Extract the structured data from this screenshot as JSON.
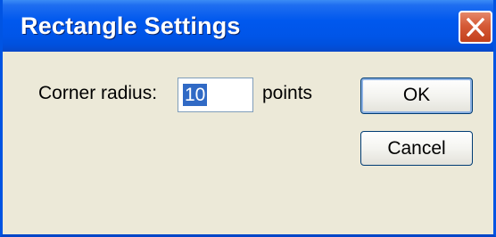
{
  "dialog": {
    "title": "Rectangle Settings",
    "close_icon": "close-icon",
    "corner_radius_label": "Corner radius:",
    "corner_radius_value": "10",
    "units_label": "points",
    "ok_label": "OK",
    "cancel_label": "Cancel"
  },
  "colors": {
    "titlebar": "#0055e8",
    "close_button": "#d55a36",
    "dialog_background": "#ece9d8",
    "selection_highlight": "#316ac5"
  }
}
